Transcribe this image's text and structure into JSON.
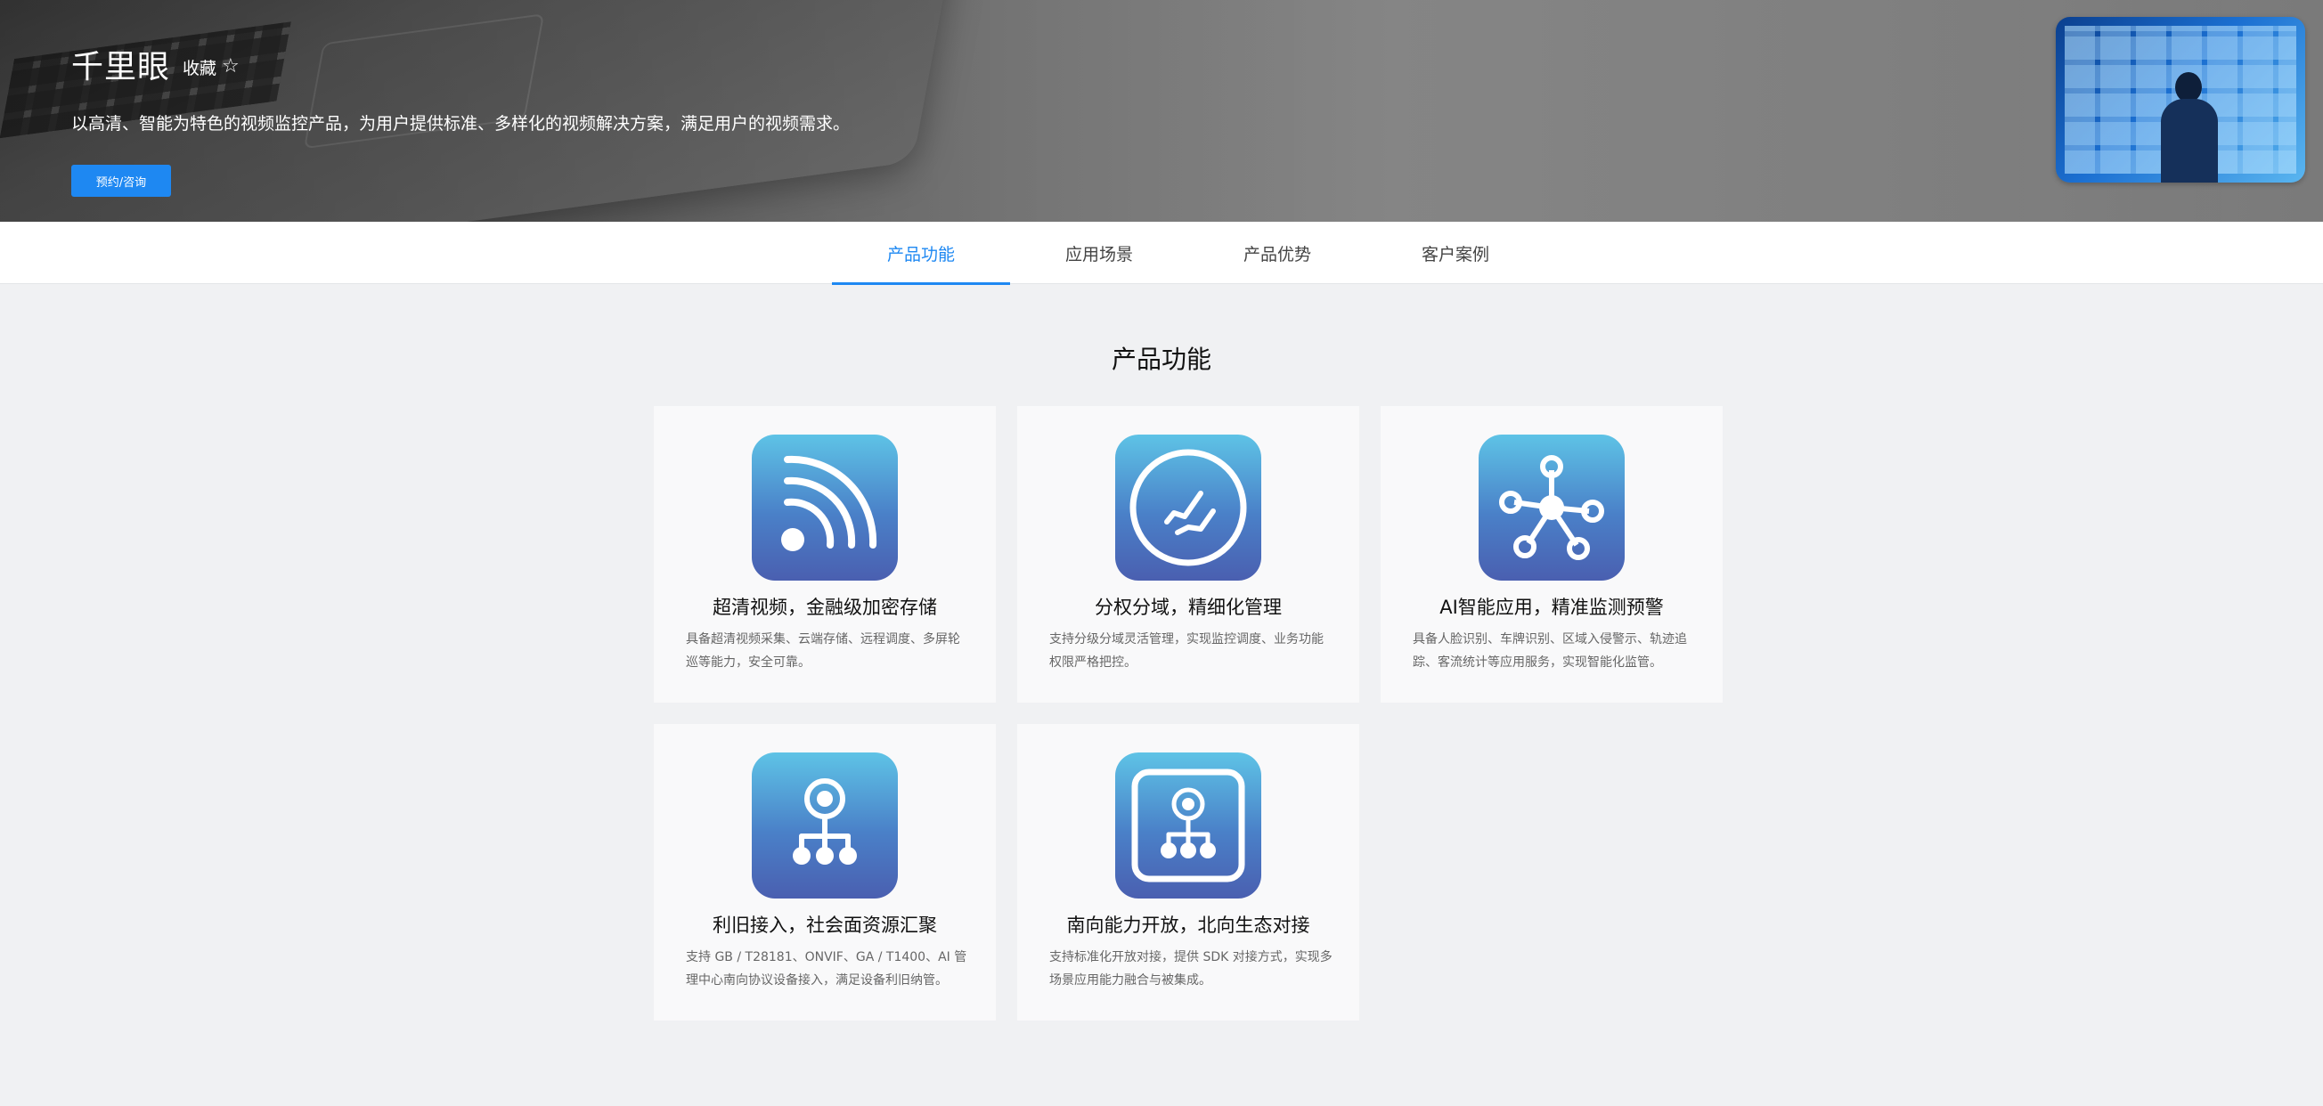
{
  "product": {
    "title": "千里眼",
    "favorite_label": "收藏",
    "favorite_icon": "star-outline-icon",
    "subtitle": "以高清、智能为特色的视频监控产品，为用户提供标准、多样化的视频解决方案，满足用户的视频需求。",
    "consult_button": "预约/咨询",
    "accent_color": "#1e88f2"
  },
  "tabs": [
    {
      "label": "产品功能",
      "active": true
    },
    {
      "label": "应用场景",
      "active": false
    },
    {
      "label": "产品优势",
      "active": false
    },
    {
      "label": "客户案例",
      "active": false
    }
  ],
  "features": {
    "section_title": "产品功能",
    "cards": [
      {
        "icon": "signal-broadcast-icon",
        "title": "超清视频，金融级加密存储",
        "desc": "具备超清视频采集、云端存储、远程调度、多屏轮巡等能力，安全可靠。"
      },
      {
        "icon": "domain-split-icon",
        "title": "分权分域，精细化管理",
        "desc": "支持分级分域灵活管理，实现监控调度、业务功能权限严格把控。"
      },
      {
        "icon": "network-hub-icon",
        "title": "AI智能应用，精准监测预警",
        "desc": "具备人脸识别、车牌识别、区域入侵警示、轨迹追踪、客流统计等应用服务，实现智能化监管。"
      },
      {
        "icon": "org-tree-icon",
        "title": "利旧接入，社会面资源汇聚",
        "desc": "支持 GB / T28181、ONVIF、GA / T1400、AI 管理中心南向协议设备接入，满足设备利旧纳管。"
      },
      {
        "icon": "framed-org-tree-icon",
        "title": "南向能力开放，北向生态对接",
        "desc": "支持标准化开放对接，提供 SDK 对接方式，实现多场景应用能力融合与被集成。"
      }
    ]
  }
}
